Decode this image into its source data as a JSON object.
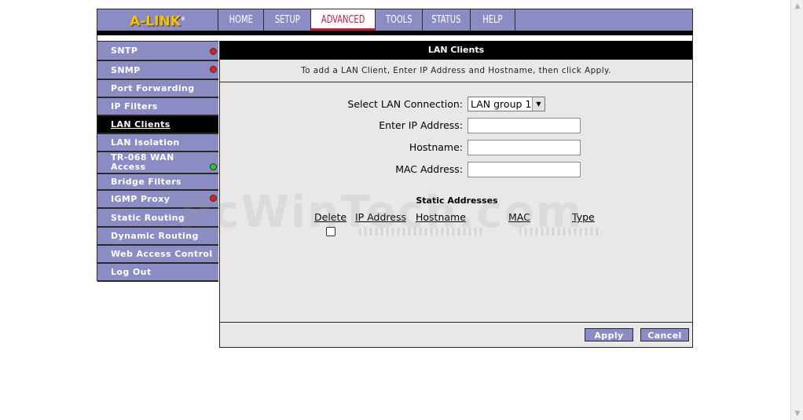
{
  "brand": {
    "logo_text": "A-LINK",
    "logo_mark": "®"
  },
  "topnav": {
    "tabs": [
      {
        "label": "HOME"
      },
      {
        "label": "SETUP"
      },
      {
        "label": "ADVANCED",
        "active": true
      },
      {
        "label": "TOOLS"
      },
      {
        "label": "STATUS"
      },
      {
        "label": "HELP"
      }
    ]
  },
  "sidebar": {
    "items": [
      {
        "label": "SNTP",
        "status": "red"
      },
      {
        "label": "SNMP",
        "status": "red"
      },
      {
        "label": "Port Forwarding"
      },
      {
        "label": "IP Filters"
      },
      {
        "label": "LAN Clients",
        "active": true
      },
      {
        "label": "LAN Isolation"
      },
      {
        "label": "TR-068 WAN Access",
        "status": "green"
      },
      {
        "label": "Bridge Filters"
      },
      {
        "label": "IGMP Proxy",
        "status": "red"
      },
      {
        "label": "Static Routing"
      },
      {
        "label": "Dynamic Routing"
      },
      {
        "label": "Web Access Control"
      },
      {
        "label": "Log Out"
      }
    ]
  },
  "main": {
    "title": "LAN Clients",
    "description": "To add a LAN Client, Enter IP Address and Hostname, then click Apply.",
    "form": {
      "select_label": "Select LAN Connection:",
      "select_value": "LAN group 1",
      "ip_label": "Enter IP Address:",
      "ip_value": "",
      "hostname_label": "Hostname:",
      "hostname_value": "",
      "mac_label": "MAC Address:",
      "mac_value": ""
    },
    "static_addresses": {
      "title": "Static Addresses",
      "columns": [
        "Delete",
        "IP Address",
        "Hostname",
        "MAC",
        "Type"
      ]
    },
    "buttons": {
      "apply": "Apply",
      "cancel": "Cancel"
    }
  },
  "watermark": "PcWinTech.com",
  "colors": {
    "nav_bg": "#8c8cc4",
    "active_tab_text": "#c0203a",
    "logo": "#f2c20a",
    "status_red": "#e81a1a",
    "status_green": "#22cc22",
    "panel_bg": "#e8e8e8"
  }
}
